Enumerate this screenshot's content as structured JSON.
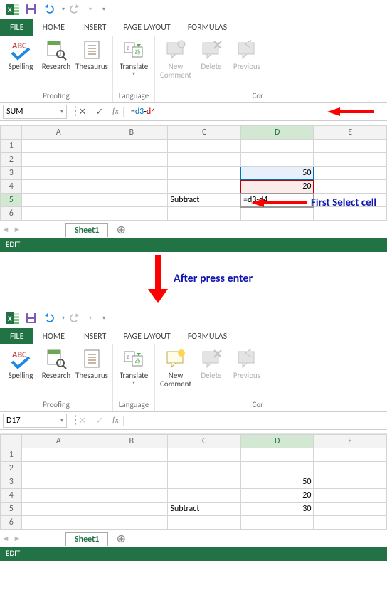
{
  "app_top": {
    "ribbon_tabs": {
      "file": "FILE",
      "home": "HOME",
      "insert": "INSERT",
      "page": "PAGE LAYOUT",
      "formulas": "FORMULAS"
    },
    "groups": {
      "proofing": {
        "label": "Proofing",
        "spelling": "Spelling",
        "research": "Research",
        "thesaurus": "Thesaurus"
      },
      "language": {
        "label": "Language",
        "translate": "Translate"
      },
      "comments": {
        "label_cut": "Cor",
        "new_comment": "New\nComment",
        "new_comment_line1": "New",
        "new_comment_line2": "Comment",
        "delete": "Delete",
        "previous": "Previous"
      }
    },
    "namebox": "SUM",
    "fx_label": "fx",
    "formula_eq": "=",
    "formula_d3": "d3",
    "formula_dash": "-",
    "formula_d4": "d4",
    "cols": {
      "A": "A",
      "B": "B",
      "C": "C",
      "D": "D",
      "E": "E"
    },
    "rows": {
      "r1": "1",
      "r2": "2",
      "r3": "3",
      "r4": "4",
      "r5": "5",
      "r6": "6"
    },
    "cells": {
      "D3": "50",
      "D4": "20",
      "C5": "Subtract",
      "D5": "=d3-d4"
    },
    "sheet_tab": "Sheet1",
    "add_sheet_glyph": "⊕",
    "status": "EDIT"
  },
  "annot1": "First Select cell",
  "mid_label": "After press enter",
  "app_bottom": {
    "namebox": "D17",
    "cells": {
      "D3": "50",
      "D4": "20",
      "C5": "Subtract",
      "D5": "30"
    },
    "sheet_tab": "Sheet1",
    "status": "EDIT"
  }
}
